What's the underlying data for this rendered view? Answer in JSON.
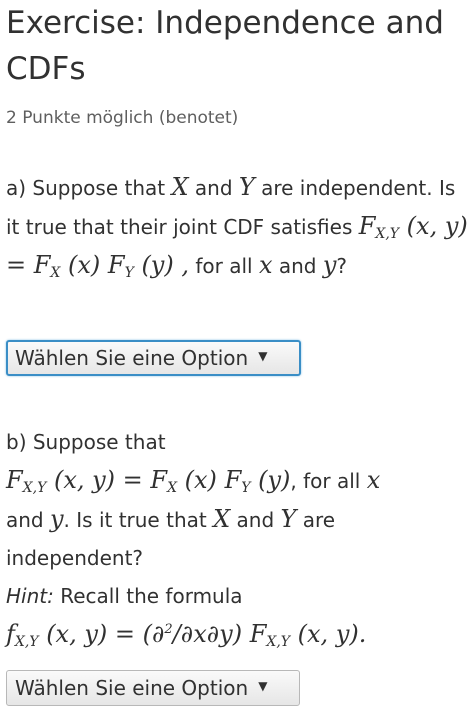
{
  "exercise": {
    "title": "Exercise: Independence and CDFs",
    "points": "2 Punkte möglich (benotet)"
  },
  "question_a": {
    "t1": "a) Suppose that ",
    "var_x": "X",
    "t2": " and ",
    "var_y": "Y",
    "t3": " are independent. Is it true that their joint CDF satisfies ",
    "formula": {
      "f1": "F",
      "s1": "X,Y",
      "a1": " (x, y) = ",
      "f2": "F",
      "s2": "X",
      "a2": " (x) ",
      "f3": "F",
      "s3": "Y",
      "a3": " (y) ,"
    },
    "t4": " for all ",
    "x": "x",
    "t5": " and ",
    "y": "y",
    "t6": "?",
    "select_label": "Wählen Sie eine Option",
    "select_arrow": "▼"
  },
  "question_b": {
    "t1": "b) Suppose that ",
    "formula": {
      "f1": "F",
      "s1": "X,Y",
      "a1": " (x, y) = ",
      "f2": "F",
      "s2": "X",
      "a2": " (x) ",
      "f3": "F",
      "s3": "Y",
      "a3": " (y)"
    },
    "t2": ", for all ",
    "x": "x",
    "t3": " and ",
    "y": "y",
    "t4": ". Is it true that ",
    "var_x": "X",
    "t5": " and ",
    "var_y": "Y",
    "t6": " are independent?",
    "hint_label": "Hint:",
    "hint_text": " Recall the formula ",
    "hint_formula": {
      "f1": "f",
      "s1": "X,Y",
      "a1": " (x, y) = (∂",
      "sup": "2",
      "a2": "/∂x∂y) ",
      "f2": "F",
      "s2": "X,Y",
      "a3": " (x, y)."
    },
    "select_label": "Wählen Sie eine Option",
    "select_arrow": "▼"
  }
}
